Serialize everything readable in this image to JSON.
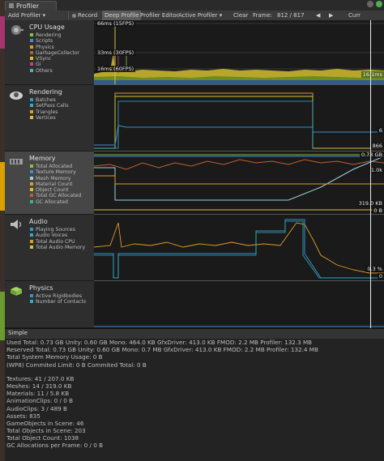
{
  "window": {
    "tab_title": "Profiler"
  },
  "toolbar": {
    "add_profiler": "Add Profiler ▾",
    "record": "Record",
    "deep_profile": "Deep Profile",
    "profiler_editor": "Profiler Editor",
    "active_profiler": "Active Profiler ▾",
    "clear": "Clear",
    "frame_label": "Frame:",
    "frame_value": "812 / 817"
  },
  "areas": [
    {
      "title": "CPU Usage",
      "items": [
        {
          "label": "Rendering",
          "color": "#8fbf3f"
        },
        {
          "label": "Scripts",
          "color": "#3c8fd0"
        },
        {
          "label": "Physics",
          "color": "#e09b2d"
        },
        {
          "label": "GarbageCollector",
          "color": "#9b6a2e"
        },
        {
          "label": "VSync",
          "color": "#d4c23a"
        },
        {
          "label": "Gi",
          "color": "#bf3f9a"
        },
        {
          "label": "Others",
          "color": "#55b0a8"
        }
      ]
    },
    {
      "title": "Rendering",
      "items": [
        {
          "label": "Batches",
          "color": "#3c8fd0"
        },
        {
          "label": "SetPass Calls",
          "color": "#2fb0c0"
        },
        {
          "label": "Triangles",
          "color": "#e09b2d"
        },
        {
          "label": "Vertices",
          "color": "#d4c23a"
        }
      ]
    },
    {
      "title": "Memory",
      "items": [
        {
          "label": "Total Allocated",
          "color": "#8fbf3f"
        },
        {
          "label": "Texture Memory",
          "color": "#3c8fd0"
        },
        {
          "label": "Mesh Memory",
          "color": "#9bd0e0"
        },
        {
          "label": "Material Count",
          "color": "#e09b2d"
        },
        {
          "label": "Object Count",
          "color": "#d4c23a"
        },
        {
          "label": "Total GC Allocated",
          "color": "#c0602d"
        },
        {
          "label": "GC Allocated",
          "color": "#3cb090"
        }
      ]
    },
    {
      "title": "Audio",
      "items": [
        {
          "label": "Playing Sources",
          "color": "#3c8fd0"
        },
        {
          "label": "Audio Voices",
          "color": "#2fb0c0"
        },
        {
          "label": "Total Audio CPU",
          "color": "#e09b2d"
        },
        {
          "label": "Total Audio Memory",
          "color": "#d4c23a"
        }
      ]
    },
    {
      "title": "Physics",
      "items": [
        {
          "label": "Active Rigidbodies",
          "color": "#3c8fd0"
        },
        {
          "label": "Number of Contacts",
          "color": "#2fb0c0"
        }
      ]
    }
  ],
  "chart_labels": {
    "cpu_66": "66ms (15FPS)",
    "cpu_33": "33ms (30FPS)",
    "cpu_16": "16ms (60FPS)",
    "cpu_value": "16.1ms",
    "rendering_a": "6",
    "rendering_b": "866",
    "memory_a": "0.73 GB",
    "memory_b": "1.0k",
    "memory_c": "319.0 KB",
    "memory_d": "0 B",
    "audio_a": "0.3 %",
    "audio_b": "0"
  },
  "bottom": {
    "view_mode": "Simple",
    "lines": [
      "Used Total: 0.73 GB   Unity: 0.60 GB   Mono: 464.0 KB   GfxDriver: 413.0 KB   FMOD: 2.2 MB   Profiler: 132.3 MB",
      "Reserved Total: 0.73 GB   Unity: 0.60 GB   Mono: 0.7 MB   GfxDriver: 413.0 KB   FMOD: 2.2 MB   Profiler: 132.4 MB",
      "Total System Memory Usage: 0 B",
      "(WP8) Commited Limit: 0 B   Commited Total: 0 B",
      "",
      "Textures: 41 / 207.0 KB",
      "Meshes: 14 / 319.0 KB",
      "Materials: 11 / 5.8 KB",
      "AnimationClips: 0 / 0 B",
      "AudioClips: 3 / 489 B",
      "Assets: 835",
      "GameObjects in Scene: 46",
      "Total Objects in Scene: 203",
      "Total Object Count: 1038",
      "GC Allocations per Frame: 0 / 0 B"
    ]
  }
}
